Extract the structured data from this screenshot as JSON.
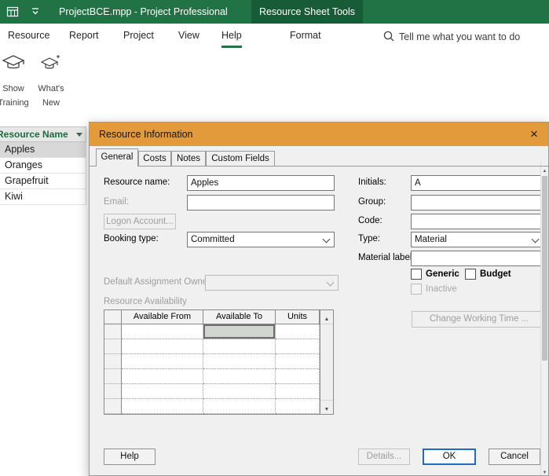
{
  "colors": {
    "titlebar_green": "#217346",
    "contextual_tab_green": "#185c37",
    "dialog_titlebar_orange": "#e29a3b",
    "default_button_blue": "#1f6bc0",
    "active_menu_underline_green": "#217346"
  },
  "titlebar": {
    "title": "ProjectBCE.mpp  -  Project Professional",
    "contextual_tab_label": "Resource Sheet Tools"
  },
  "menubar": {
    "items": [
      "Resource",
      "Report",
      "Project",
      "View",
      "Help"
    ],
    "active_item": "Help",
    "format_item": "Format",
    "search_placeholder": "Tell me what you want to do"
  },
  "ribbon": {
    "show_training_label": "Show Training",
    "whats_new_label": "What's New"
  },
  "sheet": {
    "column_header": "Resource Name",
    "rows": [
      "Apples",
      "Oranges",
      "Grapefruit",
      "Kiwi"
    ],
    "selected_row": "Apples"
  },
  "dialog": {
    "title": "Resource Information",
    "close_glyph": "×",
    "tabs": [
      "General",
      "Costs",
      "Notes",
      "Custom Fields"
    ],
    "active_tab": "General",
    "general": {
      "resource_name_label": "Resource name:",
      "resource_name_value": "Apples",
      "email_label": "Email:",
      "email_value": "",
      "logon_account_button": "Logon Account...",
      "booking_type_label": "Booking type:",
      "booking_type_value": "Committed",
      "initials_label": "Initials:",
      "initials_value": "A",
      "group_label": "Group:",
      "group_value": "",
      "code_label": "Code:",
      "code_value": "",
      "type_label": "Type:",
      "type_value": "Material",
      "material_label_label": "Material label:",
      "material_label_value": "",
      "generic_label": "Generic",
      "budget_label": "Budget",
      "inactive_label": "Inactive",
      "default_owner_label": "Default Assignment Owner:",
      "default_owner_value": "",
      "availability_label": "Resource Availability",
      "availability_columns": [
        "Available From",
        "Available To",
        "Units"
      ],
      "change_working_time_button": "Change Working Time ..."
    },
    "footer": {
      "help": "Help",
      "details": "Details...",
      "ok": "OK",
      "cancel": "Cancel"
    }
  }
}
